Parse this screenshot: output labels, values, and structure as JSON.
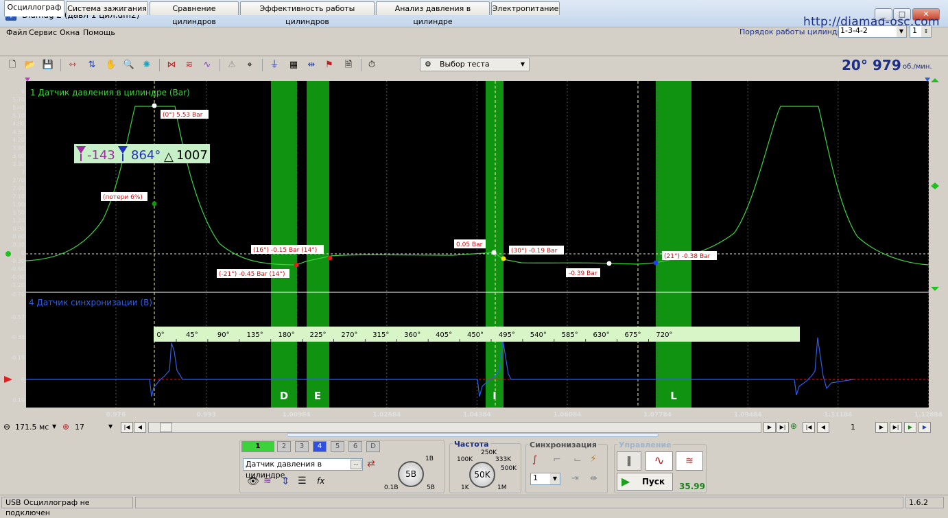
{
  "window": {
    "title": "Diamag 2 (давл 1 цил.dm2)",
    "site": "http://diamag-osc.com",
    "min": "_",
    "max": "□",
    "close": "✕"
  },
  "menu": [
    "Файл",
    "Сервис",
    "Окна",
    "Помощь"
  ],
  "firing_order": {
    "label": "Порядок работы цилиндров",
    "value": "1-3-4-2",
    "cylinder": "1"
  },
  "tabs": [
    "Осциллограф",
    "Система зажигания",
    "Сравнение цилиндров",
    "Эффективность работы цилиндров",
    "Анализ давления в цилиндре",
    "Электропитание"
  ],
  "toolbar": {
    "test_select": "Выбор теста"
  },
  "rpm": {
    "angle": "20°",
    "value": "979",
    "unit": "об./мин."
  },
  "channel1": {
    "title": "1 Датчик давления в цилиндре (Bar)",
    "ticks": [
      "6",
      "5.70",
      "5.40",
      "5.10",
      "4.80",
      "4.50",
      "4.20",
      "3.90",
      "3.60",
      "3.30",
      "3",
      "2.70",
      "2.40",
      "2.10",
      "1.80",
      "1.50",
      "1.20",
      "0.90",
      "0.60",
      "0.30",
      "0",
      "-0.30",
      "-0.60",
      "-0.90",
      "-1.20"
    ],
    "cursor_readout": {
      "left": "-143",
      "right": "864°",
      "delta": "1007"
    },
    "annotations": [
      "(0°) 5.53 Bar",
      "(потери 6%)",
      "(16°) -0.15 Bar (14°)",
      "(-21°) -0.45 Bar (14°)",
      "0.05 Bar",
      "(30°) -0.19 Bar",
      "-0.39 Bar",
      "(21°) -0.38 Bar"
    ]
  },
  "channel4": {
    "title": "4 Датчик синхронизации (B)",
    "ticks": [
      "-0.76",
      "-0.57",
      "-0.38",
      "-0.19",
      "0",
      "0.19"
    ]
  },
  "degree_scale": [
    "0°",
    "45°",
    "90°",
    "135°",
    "180°",
    "225°",
    "270°",
    "315°",
    "360°",
    "405°",
    "450°",
    "495°",
    "540°",
    "585°",
    "630°",
    "675°",
    "720°"
  ],
  "zones": [
    "D",
    "E",
    "I",
    "L"
  ],
  "time_axis": [
    "0.976",
    "0.993",
    "1.00984",
    "1.02684",
    "1.04384",
    "1.06084",
    "1.07784",
    "1.09484",
    "1.11184",
    "1.12884"
  ],
  "nav": {
    "timebase": "171.5 мс",
    "frames": "17",
    "page": "1"
  },
  "channels_panel": {
    "buttons": [
      "1",
      "2",
      "3",
      "4",
      "5",
      "6",
      "D"
    ],
    "sensor": "Датчик давления в цилиндре",
    "volt_knob": "5B",
    "volt_min": "0.1B",
    "volt_max": "5B",
    "volt_top": "1B"
  },
  "freq_panel": {
    "title": "Частота",
    "knob": "50K",
    "labels": [
      "100K",
      "250K",
      "333K",
      "500K",
      "1K",
      "1M"
    ]
  },
  "sync_panel": {
    "title": "Синхронизация",
    "channel": "1"
  },
  "control_panel": {
    "title": "Управление",
    "start": "Пуск",
    "fps": "35.99"
  },
  "status": {
    "message": "USB Осциллограф не подключен",
    "version": "1.6.2"
  },
  "colors": {
    "trace1": "#3fd23f",
    "trace4": "#2f5fe8",
    "zone": "#109310",
    "readout_bg": "#c8f0c8"
  }
}
